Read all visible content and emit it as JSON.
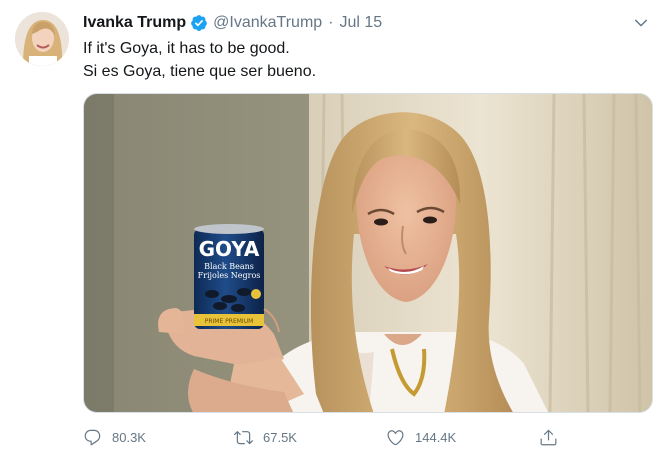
{
  "tweet": {
    "author": {
      "display_name": "Ivanka Trump",
      "handle": "@IvankaTrump",
      "verified_icon": "verified-badge-icon"
    },
    "separator": "·",
    "timestamp": "Jul 15",
    "text_lines": [
      "If it's Goya, it has to be good.",
      "Si es Goya, tiene que ser bueno."
    ],
    "media": {
      "can_brand": "GOYA",
      "can_label_1": "Black Beans",
      "can_label_2": "Frijoles Negros",
      "can_band": "PRIME PREMIUM"
    },
    "actions": {
      "reply_count": "80.3K",
      "retweet_count": "67.5K",
      "like_count": "144.4K"
    },
    "colors": {
      "text_primary": "#14171a",
      "text_secondary": "#657786",
      "verified_blue": "#1da1f2"
    }
  }
}
